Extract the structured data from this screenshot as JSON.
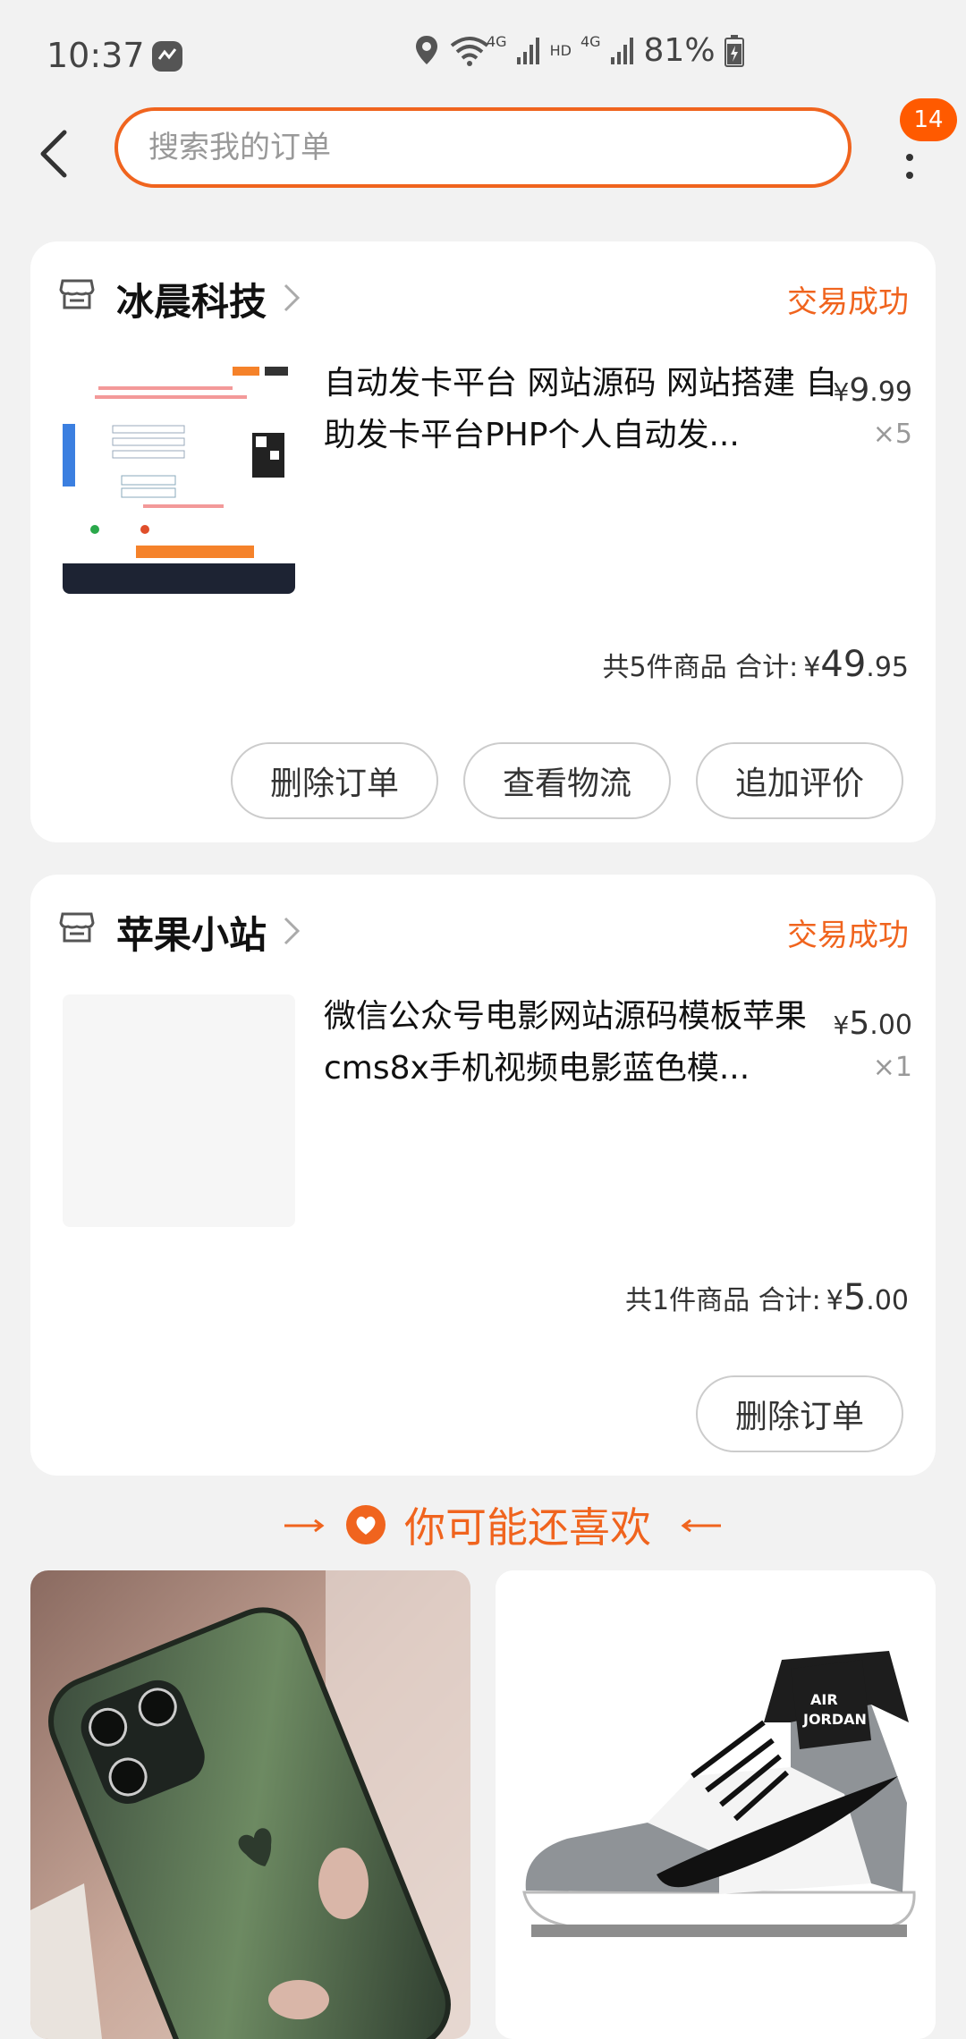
{
  "status_bar": {
    "time": "10:37",
    "battery": "81%",
    "network": "4G",
    "hd": "HD"
  },
  "header": {
    "search_placeholder": "搜索我的订单",
    "badge_count": "14"
  },
  "orders": [
    {
      "shop": "冰晨科技",
      "status": "交易成功",
      "product_title": "自动发卡平台 网站源码 网站搭建 自助发卡平台PHP个人自动发...",
      "price_currency": "¥",
      "price_int": "9",
      "price_dec": ".99",
      "qty": "×5",
      "summary_label": "共5件商品  合计:",
      "total_currency": "¥",
      "total_int": "49",
      "total_dec": ".95",
      "buttons": [
        "删除订单",
        "查看物流",
        "追加评价"
      ]
    },
    {
      "shop": "苹果小站",
      "status": "交易成功",
      "product_title": "微信公众号电影网站源码模板苹果cms8x手机视频电影蓝色模...",
      "price_currency": "¥",
      "price_int": "5",
      "price_dec": ".00",
      "qty": "×1",
      "summary_label": "共1件商品  合计:",
      "total_currency": "¥",
      "total_int": "5",
      "total_dec": ".00",
      "buttons": [
        "删除订单"
      ]
    }
  ],
  "recommend": {
    "title": "你可能还喜欢"
  },
  "colors": {
    "accent": "#f0641e",
    "badge": "#ff5a00",
    "background": "#f2f2f2"
  }
}
